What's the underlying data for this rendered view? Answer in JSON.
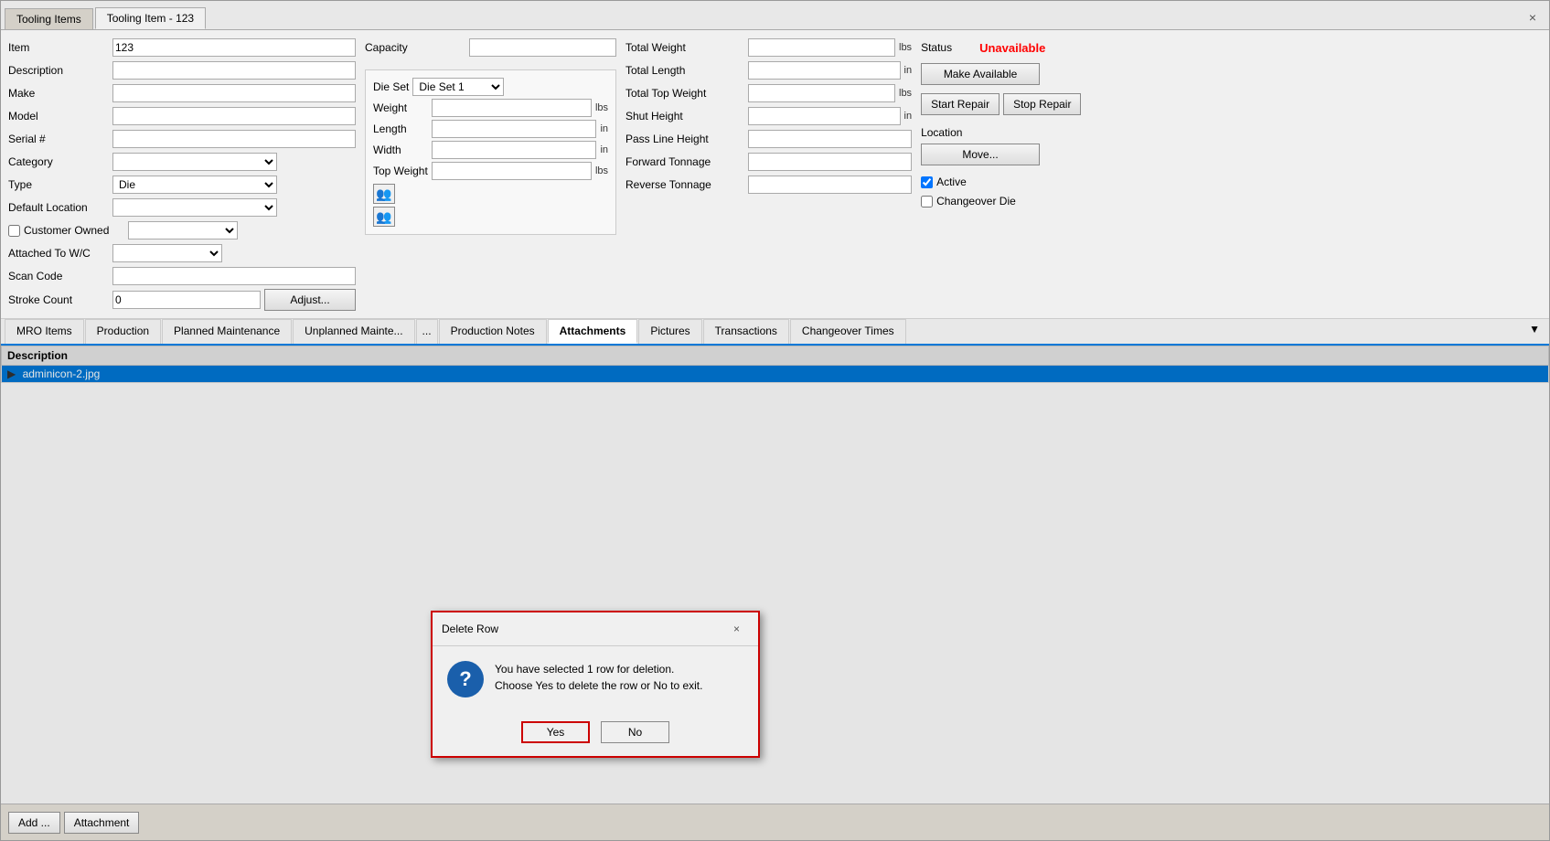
{
  "window": {
    "close_btn": "×"
  },
  "tabs": {
    "items": [
      {
        "label": "Tooling Items",
        "active": false
      },
      {
        "label": "Tooling Item - 123",
        "active": true
      }
    ]
  },
  "form": {
    "item_label": "Item",
    "item_value": "123",
    "description_label": "Description",
    "description_value": "",
    "make_label": "Make",
    "make_value": "",
    "model_label": "Model",
    "model_value": "",
    "serial_label": "Serial #",
    "serial_value": "",
    "category_label": "Category",
    "category_value": "",
    "type_label": "Type",
    "type_value": "Die",
    "default_location_label": "Default Location",
    "default_location_value": "",
    "customer_owned_label": "Customer Owned",
    "customer_owned_checked": false,
    "customer_owned_input": "",
    "attached_wc_label": "Attached To W/C",
    "attached_wc_value": "",
    "scan_code_label": "Scan Code",
    "scan_code_value": "",
    "stroke_count_label": "Stroke Count",
    "stroke_count_value": "0",
    "adjust_btn": "Adjust...",
    "capacity_label": "Capacity",
    "capacity_value": "",
    "die_set_label": "Die Set",
    "die_set_value": "Die Set 1",
    "weight_label": "Weight",
    "weight_value": "",
    "weight_unit": "lbs",
    "length_label": "Length",
    "length_value": "",
    "length_unit": "in",
    "width_label": "Width",
    "width_value": "",
    "width_unit": "in",
    "top_weight_label": "Top Weight",
    "top_weight_value": "",
    "top_weight_unit": "lbs",
    "total_weight_label": "Total Weight",
    "total_weight_value": "",
    "total_weight_unit": "lbs",
    "total_length_label": "Total Length",
    "total_length_value": "",
    "total_length_unit": "in",
    "total_top_weight_label": "Total Top Weight",
    "total_top_weight_value": "",
    "total_top_weight_unit": "lbs",
    "shut_height_label": "Shut Height",
    "shut_height_value": "",
    "shut_height_unit": "in",
    "pass_line_height_label": "Pass Line Height",
    "pass_line_height_value": "",
    "forward_tonnage_label": "Forward Tonnage",
    "forward_tonnage_value": "",
    "reverse_tonnage_label": "Reverse Tonnage",
    "reverse_tonnage_value": "",
    "status_label": "Status",
    "status_value": "Unavailable",
    "make_available_btn": "Make Available",
    "start_repair_btn": "Start Repair",
    "stop_repair_btn": "Stop Repair",
    "location_label": "Location",
    "move_btn": "Move...",
    "active_label": "Active",
    "active_checked": true,
    "changeover_die_label": "Changeover Die",
    "changeover_die_checked": false
  },
  "tabs_strip": {
    "items": [
      {
        "label": "MRO Items",
        "active": false
      },
      {
        "label": "Production",
        "active": false
      },
      {
        "label": "Planned Maintenance",
        "active": false
      },
      {
        "label": "Unplanned Mainte...",
        "active": false
      },
      {
        "label": "...",
        "active": false
      },
      {
        "label": "Production Notes",
        "active": false
      },
      {
        "label": "Attachments",
        "active": true
      },
      {
        "label": "Pictures",
        "active": false
      },
      {
        "label": "Transactions",
        "active": false
      },
      {
        "label": "Changeover Times",
        "active": false
      }
    ]
  },
  "table": {
    "columns": [
      "Description"
    ],
    "rows": [
      {
        "description": "adminicon-2.jpg",
        "selected": true
      }
    ]
  },
  "bottom_bar": {
    "add_btn": "Add ...",
    "attachment_btn": "Attachment"
  },
  "dialog": {
    "title": "Delete Row",
    "close_btn": "×",
    "message_line1": "You have selected 1 row for deletion.",
    "message_line2": "Choose Yes to delete the row or No to exit.",
    "yes_btn": "Yes",
    "no_btn": "No"
  }
}
